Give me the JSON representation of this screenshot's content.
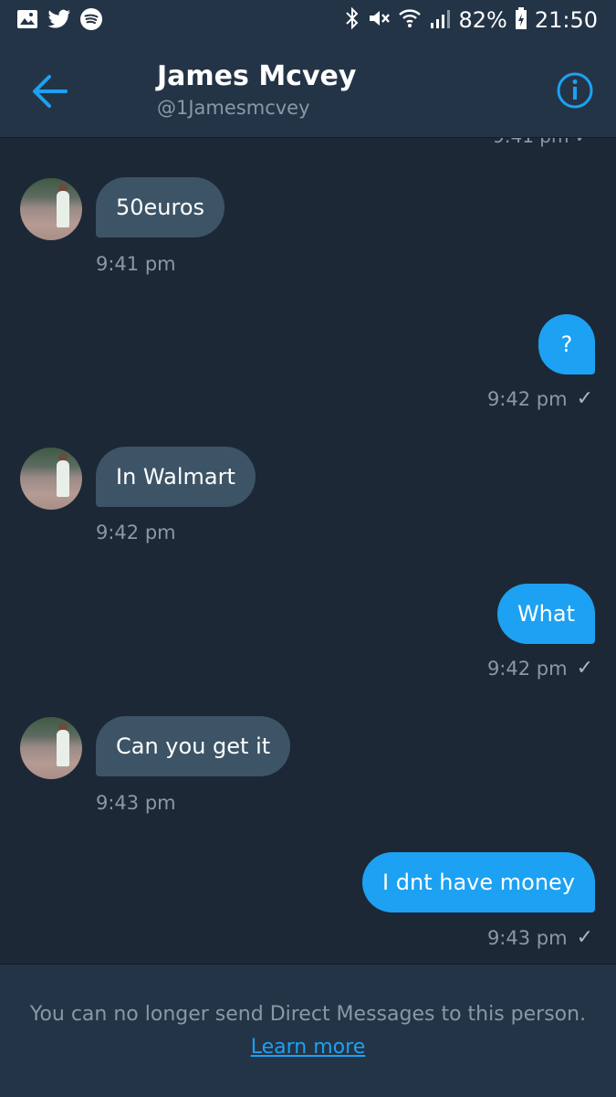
{
  "status_bar": {
    "left_icons": [
      "image-icon",
      "twitter-icon",
      "spotify-icon"
    ],
    "right_icons": [
      "bluetooth-icon",
      "mute-icon",
      "wifi-icon",
      "signal-icon"
    ],
    "battery": "82%",
    "time": "21:50"
  },
  "header": {
    "name": "James Mcvey",
    "handle": "@1Jamesmcvey",
    "back_icon": "back-arrow-icon",
    "info_icon": "info-icon"
  },
  "messages": [
    {
      "side": "in",
      "text": "50euros",
      "time": "9:41 pm"
    },
    {
      "side": "out",
      "text": "?",
      "time": "9:42 pm"
    },
    {
      "side": "in",
      "text": "In Walmart",
      "time": "9:42 pm"
    },
    {
      "side": "out",
      "text": "What",
      "time": "9:42 pm"
    },
    {
      "side": "in",
      "text": "Can you get it",
      "time": "9:43 pm"
    },
    {
      "side": "out",
      "text": "I dnt have money",
      "time": "9:43 pm"
    }
  ],
  "footer": {
    "notice": "You can no longer send Direct Messages to this person.",
    "link": "Learn more"
  },
  "colors": {
    "background": "#1c2836",
    "bar": "#243447",
    "incoming_bubble": "#3d5466",
    "outgoing_bubble": "#1da1f2",
    "muted_text": "#8899a6"
  }
}
